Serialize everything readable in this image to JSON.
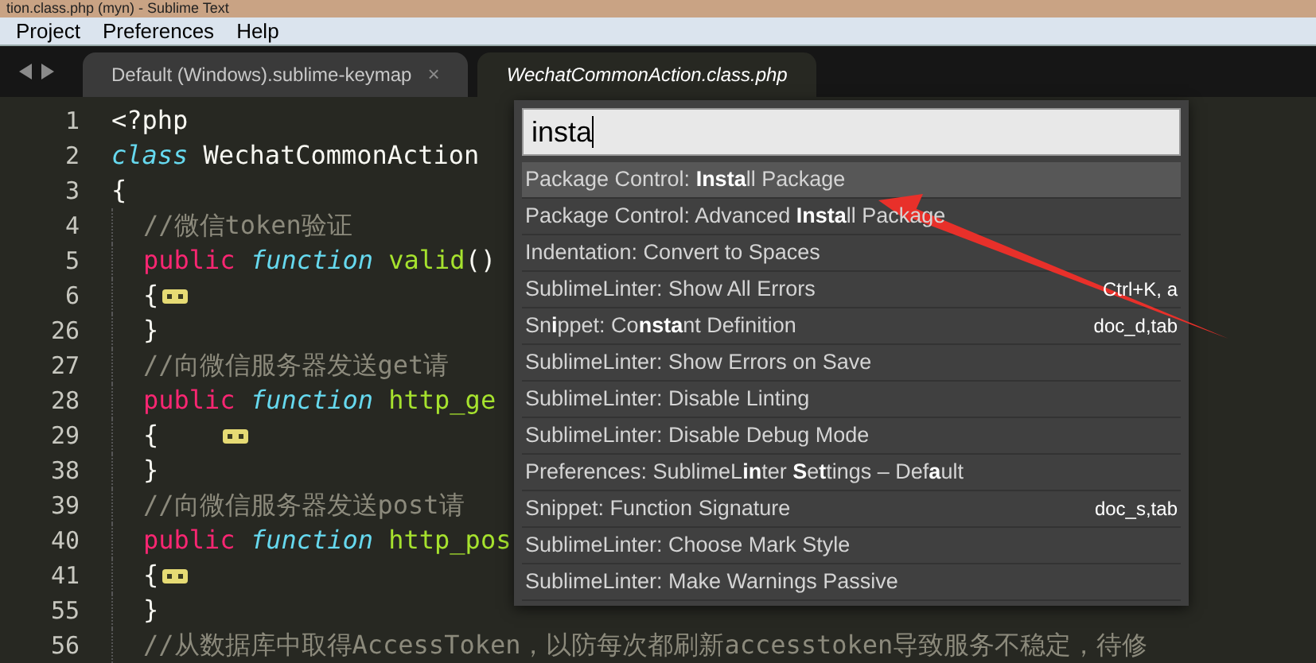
{
  "window": {
    "title": "tion.class.php (myn) - Sublime Text"
  },
  "menu": [
    "Project",
    "Preferences",
    "Help"
  ],
  "tabs": [
    {
      "label": "Default (Windows).sublime-keymap",
      "selected": false,
      "close": "×"
    },
    {
      "label": "WechatCommonAction.class.php",
      "selected": true
    }
  ],
  "code": [
    {
      "number": "1",
      "indented": false,
      "tokens": [
        {
          "kind": "plain",
          "text": "<?php"
        }
      ]
    },
    {
      "number": "2",
      "indented": false,
      "tokens": [
        {
          "kind": "storage",
          "text": "class "
        },
        {
          "kind": "plain",
          "text": "WechatCommonAction"
        }
      ]
    },
    {
      "number": "3",
      "indented": false,
      "tokens": [
        {
          "kind": "plain",
          "text": "{"
        }
      ]
    },
    {
      "number": "4",
      "indented": true,
      "tokens": [
        {
          "kind": "comment",
          "text": "//微信token验证"
        }
      ]
    },
    {
      "number": "5",
      "indented": true,
      "tokens": [
        {
          "kind": "keyword",
          "text": "public "
        },
        {
          "kind": "storage",
          "text": "function "
        },
        {
          "kind": "name",
          "text": "valid"
        },
        {
          "kind": "plain",
          "text": "()"
        }
      ]
    },
    {
      "number": "6",
      "indented": true,
      "tokens": [
        {
          "kind": "plain",
          "text": "{"
        },
        {
          "kind": "fold"
        }
      ]
    },
    {
      "number": "26",
      "indented": true,
      "tokens": [
        {
          "kind": "plain",
          "text": "}"
        }
      ]
    },
    {
      "number": "27",
      "indented": true,
      "tokens": [
        {
          "kind": "comment",
          "text": "//向微信服务器发送get请"
        }
      ]
    },
    {
      "number": "28",
      "indented": true,
      "tokens": [
        {
          "kind": "keyword",
          "text": "public "
        },
        {
          "kind": "storage",
          "text": "function "
        },
        {
          "kind": "name",
          "text": "http_ge"
        }
      ]
    },
    {
      "number": "29",
      "indented": true,
      "tokens": [
        {
          "kind": "plain",
          "text": "{    "
        },
        {
          "kind": "fold"
        }
      ]
    },
    {
      "number": "38",
      "indented": true,
      "tokens": [
        {
          "kind": "plain",
          "text": "}"
        }
      ]
    },
    {
      "number": "39",
      "indented": true,
      "tokens": [
        {
          "kind": "comment",
          "text": "//向微信服务器发送post请"
        }
      ]
    },
    {
      "number": "40",
      "indented": true,
      "tokens": [
        {
          "kind": "keyword",
          "text": "public "
        },
        {
          "kind": "storage",
          "text": "function "
        },
        {
          "kind": "name",
          "text": "http_pos"
        }
      ]
    },
    {
      "number": "41",
      "indented": true,
      "tokens": [
        {
          "kind": "plain",
          "text": "{"
        },
        {
          "kind": "fold"
        }
      ]
    },
    {
      "number": "55",
      "indented": true,
      "tokens": [
        {
          "kind": "plain",
          "text": "}"
        }
      ]
    },
    {
      "number": "56",
      "indented": true,
      "tokens": [
        {
          "kind": "comment",
          "text": "//从数据库中取得AccessToken，以防每次都刷新accesstoken导致服务不稳定，待修"
        }
      ]
    }
  ],
  "palette": {
    "query": "insta",
    "items": [
      {
        "label": "Package Control: **Insta**ll Package",
        "selected": true
      },
      {
        "label": "Package Control: Advanced **Insta**ll Package",
        "selected": false
      },
      {
        "label": "Indentation: Convert to Spaces",
        "selected": false
      },
      {
        "label": "SublimeLinter: Show All Errors",
        "shortcut": "Ctrl+K, a",
        "selected": false
      },
      {
        "label": "Sn**i**ppet: Co**nsta**nt Definition",
        "shortcut": "doc_d,tab",
        "selected": false
      },
      {
        "label": "SublimeLinter: Show Errors on Save",
        "selected": false
      },
      {
        "label": "SublimeLinter: Disable Linting",
        "selected": false
      },
      {
        "label": "SublimeLinter: Disable Debug Mode",
        "selected": false
      },
      {
        "label": "Preferences: SublimeL**in**ter **S**e**t**tings – Def**a**ult",
        "selected": false
      },
      {
        "label": "Snippet: Function Signature",
        "shortcut": "doc_s,tab",
        "selected": false
      },
      {
        "label": "SublimeLinter: Choose Mark Style",
        "selected": false
      },
      {
        "label": "SublimeLinter: Make Warnings Passive",
        "selected": false
      }
    ]
  }
}
